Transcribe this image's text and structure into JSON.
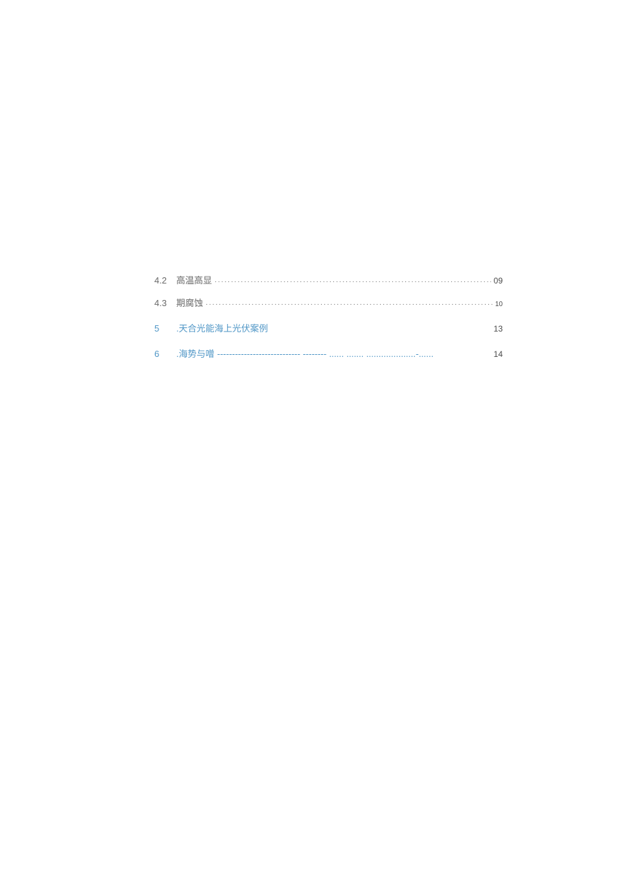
{
  "toc": {
    "entries": [
      {
        "num": "4.2",
        "title": "高温高显",
        "leader": "dots",
        "page": "09",
        "heading": false,
        "page_small": false
      },
      {
        "num": "4.3",
        "title": "期腐蚀",
        "leader": "dots",
        "page": "10",
        "heading": false,
        "page_small": true
      },
      {
        "num": "5",
        "title": ".天合光能海上光伏案例",
        "leader": "",
        "page": "13",
        "heading": true,
        "page_small": false
      },
      {
        "num": "6",
        "title": ".海势与噌",
        "leader": "dashes",
        "page": "14",
        "heading": true,
        "page_small": false
      }
    ]
  },
  "leaders": {
    "dots": "..............................................................................................................................................................",
    "dashes": "---------------------------- -------- ...... ....... ....................-......"
  }
}
